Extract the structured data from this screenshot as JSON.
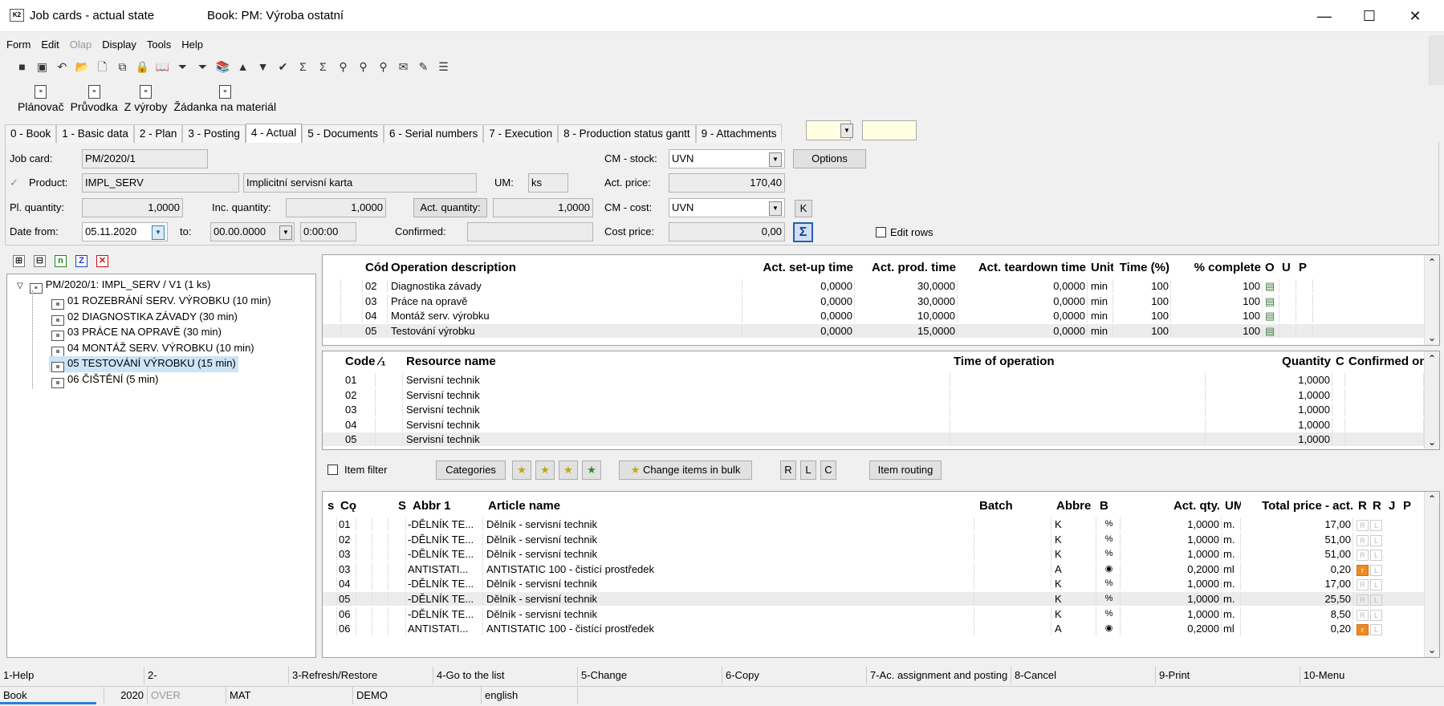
{
  "window": {
    "title": "Job cards - actual state",
    "book": "Book: PM: Výroba ostatní",
    "app_icon": "K2",
    "min": "—",
    "max": "☐",
    "close": "✕"
  },
  "menu": [
    {
      "label": "Form",
      "enabled": true
    },
    {
      "label": "Edit",
      "enabled": true
    },
    {
      "label": "Olap",
      "enabled": false
    },
    {
      "label": "Display",
      "enabled": true
    },
    {
      "label": "Tools",
      "enabled": true
    },
    {
      "label": "Help",
      "enabled": true
    }
  ],
  "toolbar": [
    {
      "name": "save-icon",
      "g": "■"
    },
    {
      "name": "save-as-icon",
      "g": "▣"
    },
    {
      "name": "undo-icon",
      "g": "↶"
    },
    {
      "name": "open-folder-icon",
      "g": "📂"
    },
    {
      "name": "new-document-icon",
      "g": "🗋"
    },
    {
      "name": "copy-icon",
      "g": "⧉"
    },
    {
      "name": "lock-icon",
      "g": "🔒"
    },
    {
      "name": "book-icon",
      "g": "📖"
    },
    {
      "name": "filter-icon",
      "g": "⏷"
    },
    {
      "name": "filter-clear-icon",
      "g": "⏷"
    },
    {
      "name": "books-icon",
      "g": "📚"
    },
    {
      "name": "arrow-up-icon",
      "g": "▲"
    },
    {
      "name": "arrow-down-icon",
      "g": "▼"
    },
    {
      "name": "mark-icon",
      "g": "✔"
    },
    {
      "name": "sum-icon",
      "g": "Σ"
    },
    {
      "name": "sum-clear-icon",
      "g": "Σ"
    },
    {
      "name": "find-icon",
      "g": "⚲"
    },
    {
      "name": "find-next-icon",
      "g": "⚲"
    },
    {
      "name": "find-prev-icon",
      "g": "⚲"
    },
    {
      "name": "mail-icon",
      "g": "✉"
    },
    {
      "name": "edit-note-icon",
      "g": "✎"
    },
    {
      "name": "menu-lines-icon",
      "g": "☰"
    }
  ],
  "big_tools": [
    {
      "label": "Plánovač"
    },
    {
      "label": "Průvodka"
    },
    {
      "label": "Z výroby"
    },
    {
      "label": "Žádanka na materiál"
    }
  ],
  "tabs": [
    {
      "label": "0 - Book"
    },
    {
      "label": "1 - Basic data"
    },
    {
      "label": "2 - Plan"
    },
    {
      "label": "3 - Posting"
    },
    {
      "label": "4 - Actual",
      "active": true
    },
    {
      "label": "5 - Documents"
    },
    {
      "label": "6 - Serial numbers"
    },
    {
      "label": "7 - Execution"
    },
    {
      "label": "8 - Production status gantt"
    },
    {
      "label": "9 - Attachments"
    }
  ],
  "form": {
    "job_card_label": "Job card:",
    "job_card": "PM/2020/1",
    "product_label": "Product:",
    "product_code": "IMPL_SERV",
    "product_name": "Implicitní servisní karta",
    "um_label": "UM:",
    "um": "ks",
    "pl_qty_label": "Pl. quantity:",
    "pl_qty": "1,0000",
    "inc_qty_label": "Inc. quantity:",
    "inc_qty": "1,0000",
    "act_qty_btn": "Act. quantity:",
    "act_qty": "1,0000",
    "date_from_label": "Date from:",
    "date_from": "05.11.2020",
    "to_label": "to:",
    "date_to": "00.00.0000",
    "time": "0:00:00",
    "confirmed_label": "Confirmed:",
    "confirmed": "",
    "cm_stock_label": "CM - stock:",
    "cm_stock": "UVN",
    "act_price_label": "Act. price:",
    "act_price": "170,40",
    "cm_cost_label": "CM - cost:",
    "cm_cost": "UVN",
    "cost_price_label": "Cost price:",
    "cost_price": "0,00",
    "options_btn": "Options",
    "k_btn": "K",
    "edit_rows": "Edit rows"
  },
  "tree_tools": [
    {
      "name": "expand-all-icon",
      "g": "⊞"
    },
    {
      "name": "collapse-all-icon",
      "g": "⊟"
    },
    {
      "name": "n-icon",
      "g": "n"
    },
    {
      "name": "z-icon",
      "g": "Z"
    },
    {
      "name": "x-icon",
      "g": "✕"
    }
  ],
  "tree": {
    "root": "PM/2020/1: IMPL_SERV / V1 (1 ks)",
    "items": [
      "01 ROZEBRÁNÍ SERV. VÝROBKU (10 min)",
      "02 DIAGNOSTIKA ZÁVADY (30 min)",
      "03 PRÁCE NA OPRAVĚ (30 min)",
      "04 MONTÁŽ SERV. VÝROBKU (10 min)",
      "05 TESTOVÁNÍ VÝROBKU (15 min)",
      "06 ČIŠTĚNÍ (5 min)"
    ],
    "selected": 4
  },
  "ops": {
    "headers": [
      "Cód",
      "Operation description",
      "Act. set-up time",
      "Act. prod. time",
      "Act. teardown time",
      "Unit",
      "Time (%)",
      "% complete",
      "O",
      "U",
      "P"
    ],
    "rows": [
      [
        "02",
        "Diagnostika závady",
        "0,0000",
        "30,0000",
        "0,0000",
        "min",
        "100",
        "100"
      ],
      [
        "03",
        "Práce na opravě",
        "0,0000",
        "30,0000",
        "0,0000",
        "min",
        "100",
        "100"
      ],
      [
        "04",
        "Montáž serv. výrobku",
        "0,0000",
        "10,0000",
        "0,0000",
        "min",
        "100",
        "100"
      ],
      [
        "05",
        "Testování výrobku",
        "0,0000",
        "15,0000",
        "0,0000",
        "min",
        "100",
        "100"
      ]
    ],
    "selected": 3
  },
  "res": {
    "headers": [
      "Code",
      "⁄₁",
      "Resource name",
      "Time of operation",
      "Quantity",
      "C",
      "Confirmed on"
    ],
    "rows": [
      [
        "01",
        "Servisní technik",
        "",
        "1,0000"
      ],
      [
        "02",
        "Servisní technik",
        "",
        "1,0000"
      ],
      [
        "03",
        "Servisní technik",
        "",
        "1,0000"
      ],
      [
        "04",
        "Servisní technik",
        "",
        "1,0000"
      ],
      [
        "05",
        "Servisní technik",
        "",
        "1,0000"
      ]
    ],
    "selected": 4
  },
  "items_toolbar": {
    "item_filter": "Item filter",
    "categories": "Categories",
    "change_bulk": "Change items in bulk",
    "r": "R",
    "l": "L",
    "c": "C",
    "item_routing": "Item routing"
  },
  "items": {
    "headers": [
      "s",
      "Cǫ",
      "S",
      "Abbr 1",
      "Article name",
      "Batch",
      "Abbre",
      "B",
      "Act. qty.",
      "UM",
      "Total price - act.",
      "R",
      "R",
      "J",
      "P"
    ],
    "rows": [
      [
        "01",
        "-DĚLNÍK TE...",
        "Dělník - servisní technik",
        "",
        "K",
        "%",
        "1,0000",
        "m.",
        "17,00",
        "R"
      ],
      [
        "02",
        "-DĚLNÍK TE...",
        "Dělník - servisní technik",
        "",
        "K",
        "%",
        "1,0000",
        "m.",
        "51,00",
        "R"
      ],
      [
        "03",
        "-DĚLNÍK TE...",
        "Dělník - servisní technik",
        "",
        "K",
        "%",
        "1,0000",
        "m.",
        "51,00",
        "R"
      ],
      [
        "03",
        "ANTISTATI...",
        "ANTISTATIC 100 - čistící prostředek",
        "",
        "A",
        "◉",
        "0,2000",
        "ml",
        "0,20",
        "r"
      ],
      [
        "04",
        "-DĚLNÍK TE...",
        "Dělník - servisní technik",
        "",
        "K",
        "%",
        "1,0000",
        "m.",
        "17,00",
        "R"
      ],
      [
        "05",
        "-DĚLNÍK TE...",
        "Dělník - servisní technik",
        "",
        "K",
        "%",
        "1,0000",
        "m.",
        "25,50",
        "R"
      ],
      [
        "06",
        "-DĚLNÍK TE...",
        "Dělník - servisní technik",
        "",
        "K",
        "%",
        "1,0000",
        "m.",
        "8,50",
        "R"
      ],
      [
        "06",
        "ANTISTATI...",
        "ANTISTATIC 100 - čistící prostředek",
        "",
        "A",
        "◉",
        "0,2000",
        "ml",
        "0,20",
        "r"
      ]
    ],
    "selected": 5,
    "l_badge": "L"
  },
  "fkeys": [
    "1-Help",
    "2-",
    "3-Refresh/Restore",
    "4-Go to the list",
    "5-Change",
    "6-Copy",
    "7-Ac. assignment and posting",
    "8-Cancel",
    "9-Print",
    "10-Menu"
  ],
  "status": [
    "Book",
    "2020",
    "OVER",
    "MAT",
    "DEMO",
    "english"
  ],
  "scroll_up": "⌃",
  "scroll_down": "⌄",
  "check": "✓",
  "sigma": "Σ",
  "dd_arrow": "▼"
}
